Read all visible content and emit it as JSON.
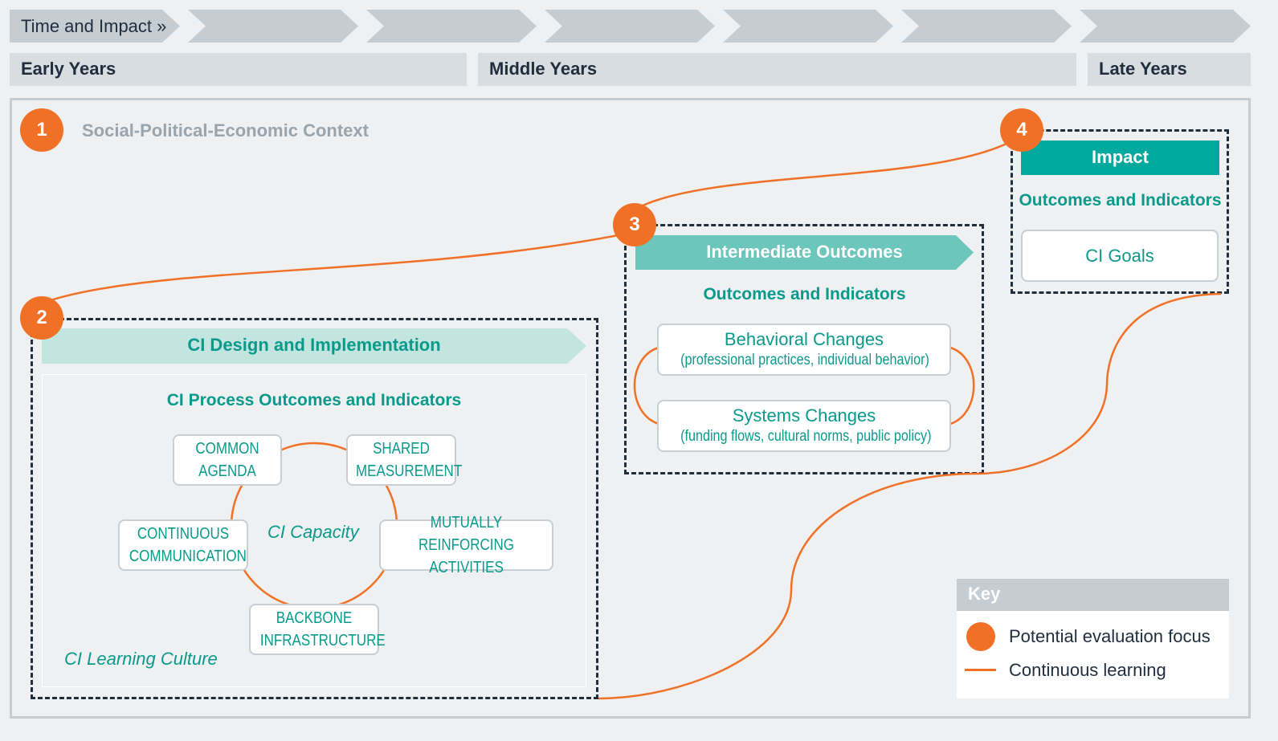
{
  "header": {
    "timeline_label": "Time and Impact »",
    "years": [
      "Early Years",
      "Middle Years",
      "Late Years"
    ]
  },
  "context": {
    "number": "1",
    "label": "Social-Political-Economic Context"
  },
  "design": {
    "number": "2",
    "banner": "CI Design and Implementation",
    "subtitle": "CI Process Outcomes and Indicators",
    "center": "CI Capacity",
    "culture": "CI Learning Culture",
    "elements": [
      [
        "COMMON",
        "AGENDA"
      ],
      [
        "SHARED",
        "MEASUREMENT"
      ],
      [
        "CONTINUOUS",
        "COMMUNICATION"
      ],
      [
        "MUTUALLY REINFORCING",
        "ACTIVITIES"
      ],
      [
        "BACKBONE",
        "INFRASTRUCTURE"
      ]
    ]
  },
  "intermediate": {
    "number": "3",
    "banner": "Intermediate Outcomes",
    "subtitle": "Outcomes and Indicators",
    "items": [
      {
        "title": "Behavioral Changes",
        "detail": "(professional practices, individual behavior)"
      },
      {
        "title": "Systems Changes",
        "detail": "(funding flows, cultural norms, public policy)"
      }
    ]
  },
  "impact": {
    "number": "4",
    "banner": "Impact",
    "subtitle": "Outcomes and Indicators",
    "goal": "CI Goals"
  },
  "key": {
    "title": "Key",
    "items": [
      "Potential evaluation focus",
      "Continuous learning"
    ]
  },
  "colors": {
    "orange": "#f07025",
    "teal": "#00a99d",
    "teal_light": "#6cc6bb",
    "teal_pale": "#c2e6df",
    "gray": "#c5ccd2"
  }
}
